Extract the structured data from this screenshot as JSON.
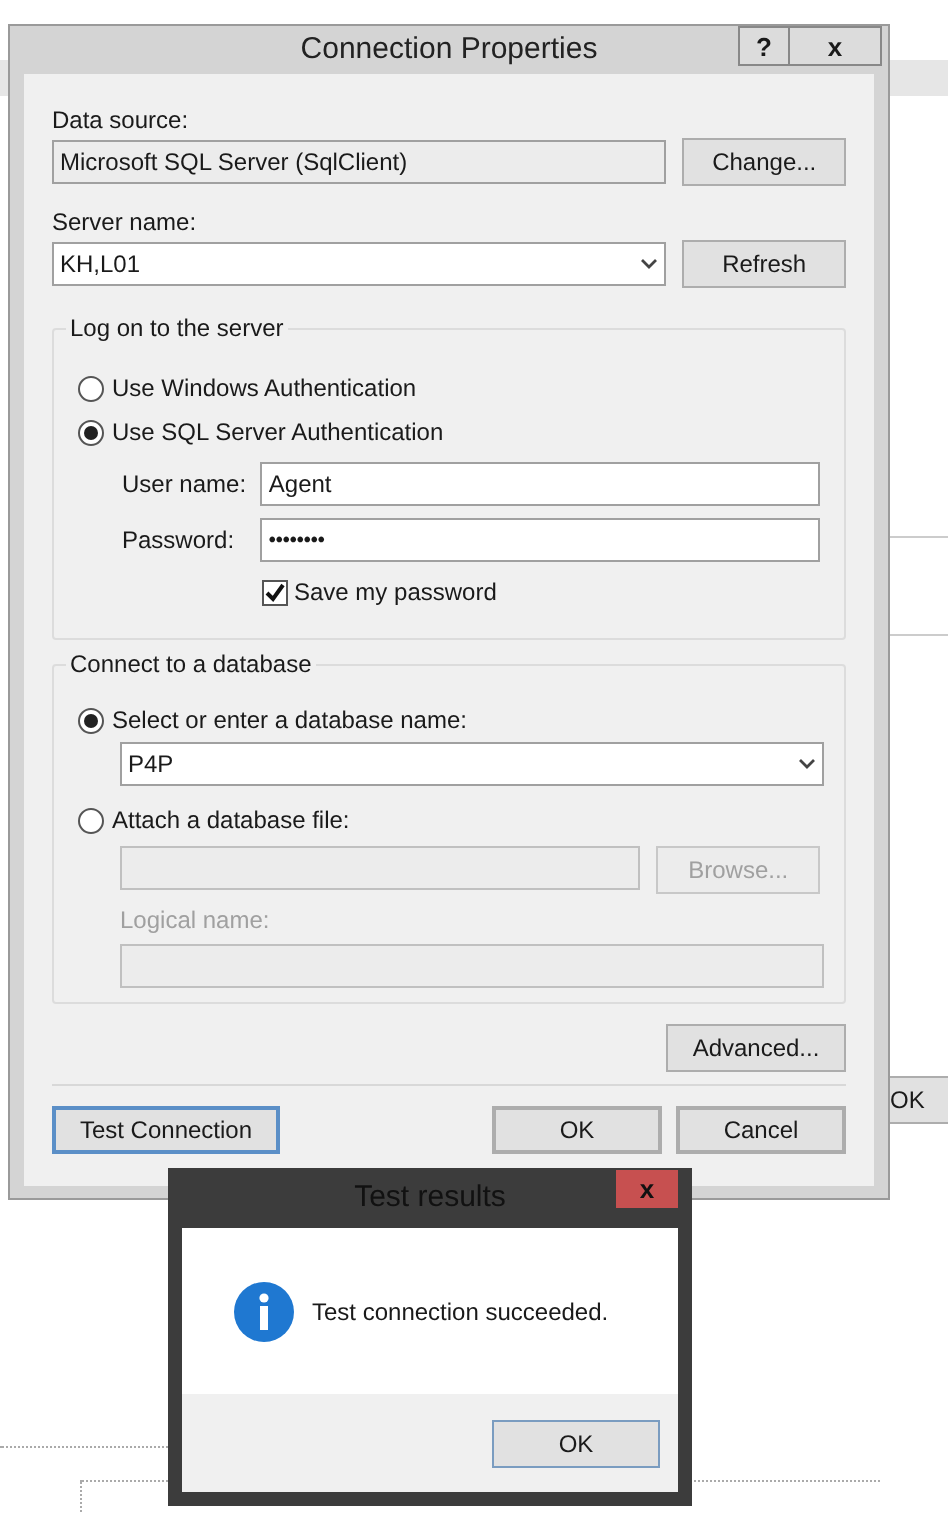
{
  "background": {
    "button": "OK"
  },
  "dialog": {
    "title": "Connection Properties",
    "title_buttons": [
      "?",
      "x"
    ],
    "data_source": {
      "label": "Data source:",
      "value": "Microsoft SQL Server (SqlClient)",
      "button": "Change..."
    },
    "server_name": {
      "label": "Server name:",
      "value": "KH,L01",
      "button": "Refresh"
    },
    "logon": {
      "title": "Log on to the server",
      "options": [
        {
          "label": "Use Windows Authentication",
          "selected": false
        },
        {
          "label": "Use SQL Server Authentication",
          "selected": true
        }
      ],
      "user_name": {
        "label": "User name:",
        "value": "Agent"
      },
      "password": {
        "label": "Password:",
        "value": "••••••••"
      },
      "save_password": {
        "label": "Save my password",
        "checked": true
      }
    },
    "database": {
      "title": "Connect to a database",
      "options": [
        {
          "label": "Select or enter a database name:",
          "selected": true
        },
        {
          "label": "Attach a database file:",
          "selected": false
        }
      ],
      "database_name": "P4P",
      "browse": {
        "label": "Browse...",
        "disabled": true
      },
      "logical_name": {
        "label": "Logical name:",
        "disabled": true
      }
    },
    "advanced": "Advanced...",
    "buttons": [
      {
        "label": "Test Connection",
        "focused": true
      },
      {
        "label": "OK",
        "focused": false
      },
      {
        "label": "Cancel",
        "focused": false
      }
    ]
  },
  "message_box": {
    "title": "Test results",
    "close": "x",
    "message": "Test connection succeeded.",
    "button": "OK"
  }
}
